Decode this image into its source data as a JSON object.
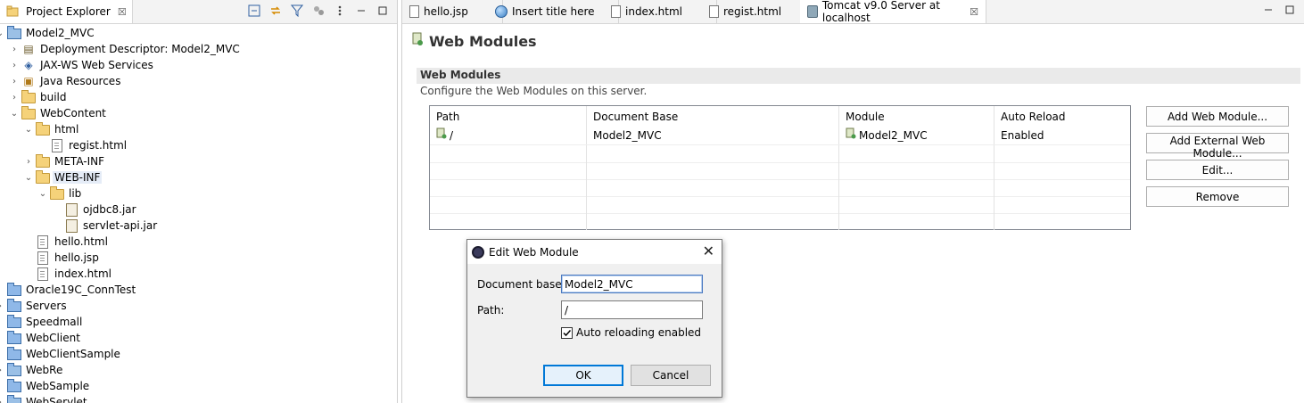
{
  "explorer": {
    "tab_label": "Project Explorer",
    "tab_close": "☒",
    "tree": [
      {
        "label": "Model2_MVC",
        "depth": 0,
        "twisty": "open",
        "icon": "project-web-icon"
      },
      {
        "label": "Deployment Descriptor: Model2_MVC",
        "depth": 1,
        "twisty": "closed",
        "icon": "deployment-descriptor-icon"
      },
      {
        "label": "JAX-WS Web Services",
        "depth": 1,
        "twisty": "closed",
        "icon": "web-services-icon"
      },
      {
        "label": "Java Resources",
        "depth": 1,
        "twisty": "closed",
        "icon": "java-resources-icon"
      },
      {
        "label": "build",
        "depth": 1,
        "twisty": "closed",
        "icon": "folder-icon"
      },
      {
        "label": "WebContent",
        "depth": 1,
        "twisty": "open",
        "icon": "folder-icon"
      },
      {
        "label": "html",
        "depth": 2,
        "twisty": "open",
        "icon": "folder-icon"
      },
      {
        "label": "regist.html",
        "depth": 3,
        "twisty": "none",
        "icon": "html-file-icon"
      },
      {
        "label": "META-INF",
        "depth": 2,
        "twisty": "closed",
        "icon": "folder-icon"
      },
      {
        "label": "WEB-INF",
        "depth": 2,
        "twisty": "open",
        "icon": "folder-icon",
        "selected": true
      },
      {
        "label": "lib",
        "depth": 3,
        "twisty": "open",
        "icon": "folder-icon"
      },
      {
        "label": "ojdbc8.jar",
        "depth": 4,
        "twisty": "none",
        "icon": "jar-file-icon"
      },
      {
        "label": "servlet-api.jar",
        "depth": 4,
        "twisty": "none",
        "icon": "jar-file-icon"
      },
      {
        "label": "hello.html",
        "depth": 2,
        "twisty": "none",
        "icon": "html-file-icon"
      },
      {
        "label": "hello.jsp",
        "depth": 2,
        "twisty": "none",
        "icon": "jsp-file-icon"
      },
      {
        "label": "index.html",
        "depth": 2,
        "twisty": "none",
        "icon": "html-file-icon"
      },
      {
        "label": "Oracle19C_ConnTest",
        "depth": 0,
        "twisty": "none",
        "icon": "project-icon"
      },
      {
        "label": "Servers",
        "depth": 0,
        "twisty": "closed",
        "icon": "project-icon"
      },
      {
        "label": "Speedmall",
        "depth": 0,
        "twisty": "none",
        "icon": "project-icon"
      },
      {
        "label": "WebClient",
        "depth": 0,
        "twisty": "none",
        "icon": "project-icon"
      },
      {
        "label": "WebClientSample",
        "depth": 0,
        "twisty": "none",
        "icon": "project-icon"
      },
      {
        "label": "WebRe",
        "depth": 0,
        "twisty": "closed",
        "icon": "project-web-icon"
      },
      {
        "label": "WebSample",
        "depth": 0,
        "twisty": "none",
        "icon": "project-icon"
      },
      {
        "label": "WebServlet",
        "depth": 0,
        "twisty": "closed",
        "icon": "project-web-icon"
      }
    ]
  },
  "editor": {
    "tabs": [
      {
        "label": "hello.jsp",
        "icon": "jsp-file-icon"
      },
      {
        "label": "Insert title here",
        "icon": "globe-icon"
      },
      {
        "label": "index.html",
        "icon": "html-file-icon"
      },
      {
        "label": "regist.html",
        "icon": "html-file-icon"
      },
      {
        "label": "Tomcat v9.0 Server at localhost",
        "icon": "server-icon",
        "active": true,
        "close": "☒"
      }
    ],
    "page_title": "Web Modules",
    "section_title": "Web Modules",
    "section_desc": "Configure the Web Modules on this server.",
    "table": {
      "columns": [
        "Path",
        "Document Base",
        "Module",
        "Auto Reload"
      ],
      "rows": [
        {
          "path": "/",
          "document_base": "Model2_MVC",
          "module": "Model2_MVC",
          "auto_reload": "Enabled"
        }
      ]
    },
    "buttons": {
      "add_module": "Add Web Module...",
      "add_external": "Add External Web Module...",
      "edit": "Edit...",
      "remove": "Remove"
    }
  },
  "dialog": {
    "title": "Edit Web Module",
    "close": "✕",
    "document_base_label": "Document base:",
    "document_base_value": "Model2_MVC",
    "path_label": "Path:",
    "path_value": "/",
    "auto_reload_label": "Auto reloading enabled",
    "auto_reload_checked": true,
    "ok_label": "OK",
    "cancel_label": "Cancel"
  }
}
